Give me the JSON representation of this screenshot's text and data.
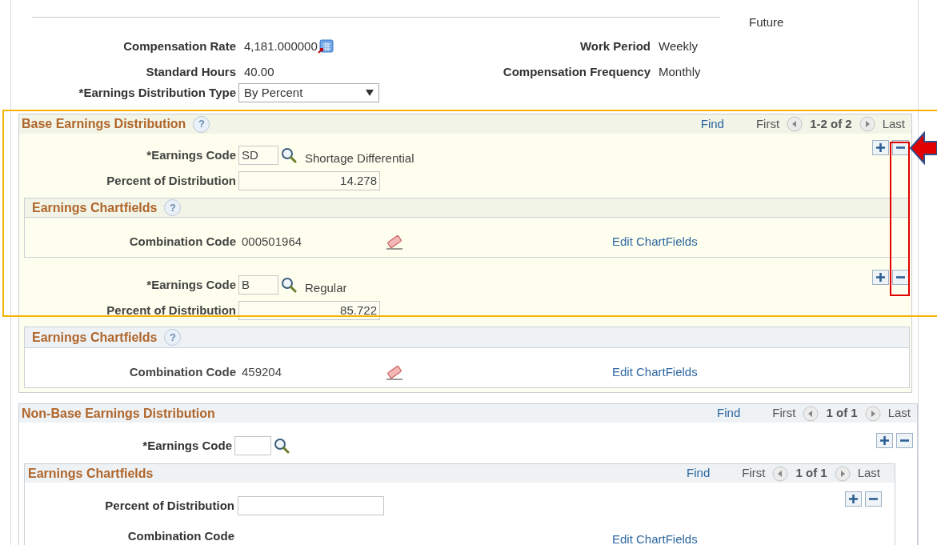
{
  "status_label": "Future",
  "summary_rows": [
    {
      "left": {
        "label": "Compensation Rate",
        "value": "4,181.000000",
        "kind": "calculator"
      },
      "right": {
        "label": "Work Period",
        "value": "Weekly",
        "kind": "text"
      }
    },
    {
      "left": {
        "label": "Standard Hours",
        "value": "40.00",
        "kind": "text"
      },
      "right": {
        "label": "Compensation Frequency",
        "value": "Monthly",
        "kind": "text"
      }
    },
    {
      "left": {
        "label": "*Earnings Distribution Type",
        "value": "By Percent",
        "kind": "select"
      }
    }
  ],
  "base_earnings_distribution": {
    "title": "Base Earnings Distribution",
    "help": "?",
    "highlighted": true,
    "nav": {
      "find": "Find",
      "first": "First",
      "count": "1-2 of 2",
      "last": "Last"
    },
    "rows": [
      {
        "highlighted": true,
        "earnings_code_label": "*Earnings Code",
        "earnings_code": "SD",
        "description": "Shortage Differential",
        "percent_label": "Percent of Distribution",
        "percent": "14.278",
        "chartfields": {
          "highlighted": true,
          "title": "Earnings Chartfields",
          "help": "?",
          "combination_label": "Combination Code",
          "combination_code": "000501964",
          "link": "Edit ChartFields"
        }
      },
      {
        "highlighted": true,
        "earnings_code_label": "*Earnings Code",
        "earnings_code": "B",
        "description": "Regular",
        "percent_label": "Percent of Distribution",
        "percent": "85.722",
        "chartfields": {
          "highlighted": false,
          "title": "Earnings Chartfields",
          "help": "?",
          "combination_label": "Combination Code",
          "combination_code": "459204",
          "link": "Edit ChartFields"
        }
      }
    ]
  },
  "non_base_earnings_distribution": {
    "title": "Non-Base Earnings Distribution",
    "nav": {
      "find": "Find",
      "first": "First",
      "count": "1 of 1",
      "last": "Last"
    },
    "earnings_code_label": "*Earnings Code",
    "chartfields": {
      "title": "Earnings Chartfields",
      "nav": {
        "find": "Find",
        "first": "First",
        "count": "1 of 1",
        "last": "Last"
      },
      "percent_label": "Percent of Distribution",
      "combination_label": "Combination Code",
      "link": "Edit ChartFields"
    }
  }
}
